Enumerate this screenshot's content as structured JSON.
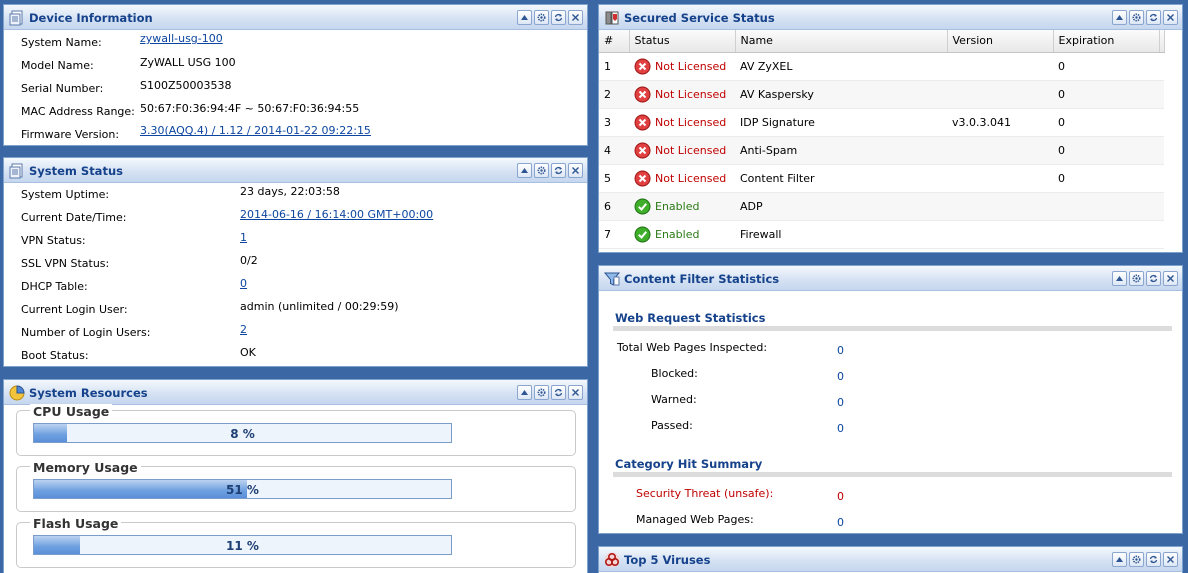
{
  "device_info": {
    "title": "Device Information",
    "rows": [
      {
        "label": "System Name:",
        "value": "zywall-usg-100",
        "link": true
      },
      {
        "label": "Model Name:",
        "value": "ZyWALL USG 100",
        "link": false
      },
      {
        "label": "Serial Number:",
        "value": "S100Z50003538",
        "link": false
      },
      {
        "label": "MAC Address Range:",
        "value": "50:67:F0:36:94:4F ~ 50:67:F0:36:94:55",
        "link": false
      },
      {
        "label": "Firmware Version:",
        "value": "3.30(AQQ.4) / 1.12 / 2014-01-22 09:22:15",
        "link": true
      }
    ]
  },
  "system_status": {
    "title": "System Status",
    "rows": [
      {
        "label": "System Uptime:",
        "value": "23 days, 22:03:58",
        "link": false
      },
      {
        "label": "Current Date/Time:",
        "value": "2014-06-16 / 16:14:00 GMT+00:00",
        "link": true
      },
      {
        "label": "VPN Status:",
        "value": "1",
        "link": true
      },
      {
        "label": "SSL VPN Status:",
        "value": "0/2",
        "link": false
      },
      {
        "label": "DHCP Table:",
        "value": "0",
        "link": true
      },
      {
        "label": "Current Login User:",
        "value": "admin (unlimited / 00:29:59)",
        "link": false
      },
      {
        "label": "Number of Login Users:",
        "value": "2",
        "link": true
      },
      {
        "label": "Boot Status:",
        "value": "OK",
        "link": false
      }
    ]
  },
  "system_resources": {
    "title": "System Resources",
    "items": [
      {
        "label": "CPU Usage",
        "percent_text": "8 %",
        "percent": 8
      },
      {
        "label": "Memory Usage",
        "percent_text": "51 %",
        "percent": 51
      },
      {
        "label": "Flash Usage",
        "percent_text": "11 %",
        "percent": 11
      }
    ]
  },
  "secured_service": {
    "title": "Secured Service Status",
    "columns": [
      "#",
      "Status",
      "Name",
      "Version",
      "Expiration"
    ],
    "rows": [
      {
        "num": "1",
        "status": "Not Licensed",
        "ok": false,
        "name": "AV ZyXEL",
        "version": "",
        "expiration": "0"
      },
      {
        "num": "2",
        "status": "Not Licensed",
        "ok": false,
        "name": "AV Kaspersky",
        "version": "",
        "expiration": "0"
      },
      {
        "num": "3",
        "status": "Not Licensed",
        "ok": false,
        "name": "IDP Signature",
        "version": "v3.0.3.041",
        "expiration": "0"
      },
      {
        "num": "4",
        "status": "Not Licensed",
        "ok": false,
        "name": "Anti-Spam",
        "version": "",
        "expiration": "0"
      },
      {
        "num": "5",
        "status": "Not Licensed",
        "ok": false,
        "name": "Content Filter",
        "version": "",
        "expiration": "0"
      },
      {
        "num": "6",
        "status": "Enabled",
        "ok": true,
        "name": "ADP",
        "version": "",
        "expiration": ""
      },
      {
        "num": "7",
        "status": "Enabled",
        "ok": true,
        "name": "Firewall",
        "version": "",
        "expiration": ""
      }
    ],
    "colors": {
      "not_licensed": "#c00000",
      "enabled": "#2c7b15"
    }
  },
  "content_filter": {
    "title": "Content Filter Statistics",
    "web_request_heading": "Web Request Statistics",
    "total_label": "Total Web Pages Inspected:",
    "total_value": "0",
    "blocked_label": "Blocked:",
    "blocked_value": "0",
    "warned_label": "Warned:",
    "warned_value": "0",
    "passed_label": "Passed:",
    "passed_value": "0",
    "category_heading": "Category Hit Summary",
    "threat_label": "Security Threat (unsafe):",
    "threat_value": "0",
    "managed_label": "Managed Web Pages:",
    "managed_value": "0"
  },
  "top_viruses": {
    "title": "Top 5 Viruses"
  },
  "portlet_tools": [
    "collapse-icon",
    "settings-icon",
    "refresh-icon",
    "close-icon"
  ]
}
